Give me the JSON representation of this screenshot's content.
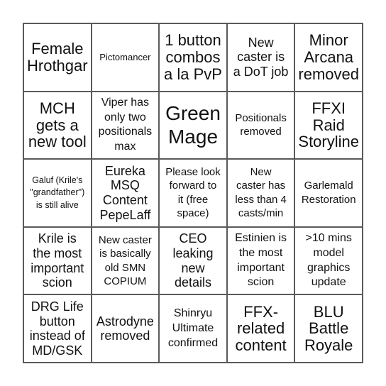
{
  "board": {
    "cells": [
      {
        "text": "Female\nHrothgar",
        "size": "s-l"
      },
      {
        "text": "Pictomancer",
        "size": "s-xs"
      },
      {
        "text": "1 button\ncombos\na la PvP",
        "size": "s-l"
      },
      {
        "text": "New\ncaster is\na DoT job",
        "size": "s-m"
      },
      {
        "text": "Minor\nArcana\nremoved",
        "size": "s-l"
      },
      {
        "text": "MCH\ngets a\nnew tool",
        "size": "s-l"
      },
      {
        "text": "Viper has\nonly two\npositionals\nmax",
        "size": "s-ms"
      },
      {
        "text": "Green\nMage",
        "size": "s-xl"
      },
      {
        "text": "Positionals\nremoved",
        "size": "s-s"
      },
      {
        "text": "FFXI\nRaid\nStoryline",
        "size": "s-l"
      },
      {
        "text": "Galuf (Krile's\n\"grandfather\")\nis still alive",
        "size": "s-xxs"
      },
      {
        "text": "Eureka\nMSQ\nContent\nPepeLaff",
        "size": "s-m"
      },
      {
        "text": "Please look\nforward to\nit (free\nspace)",
        "size": "s-s"
      },
      {
        "text": "New\ncaster has\nless than 4\ncasts/min",
        "size": "s-s"
      },
      {
        "text": "Garlemald\nRestoration",
        "size": "s-s"
      },
      {
        "text": "Krile is\nthe most\nimportant\nscion",
        "size": "s-m"
      },
      {
        "text": "New caster\nis basically\nold SMN\nCOPIUM",
        "size": "s-s"
      },
      {
        "text": "CEO\nleaking\nnew\ndetails",
        "size": "s-m"
      },
      {
        "text": "Estinien is\nthe most\nimportant\nscion",
        "size": "s-ms"
      },
      {
        "text": ">10 mins\nmodel\ngraphics\nupdate",
        "size": "s-ms"
      },
      {
        "text": "DRG Life\nbutton\ninstead of\nMD/GSK",
        "size": "s-m"
      },
      {
        "text": "Astrodyne\nremoved",
        "size": "s-m"
      },
      {
        "text": "Shinryu\nUltimate\nconfirmed",
        "size": "s-ms"
      },
      {
        "text": "FFX-\nrelated\ncontent",
        "size": "s-l"
      },
      {
        "text": "BLU\nBattle\nRoyale",
        "size": "s-l"
      }
    ]
  }
}
